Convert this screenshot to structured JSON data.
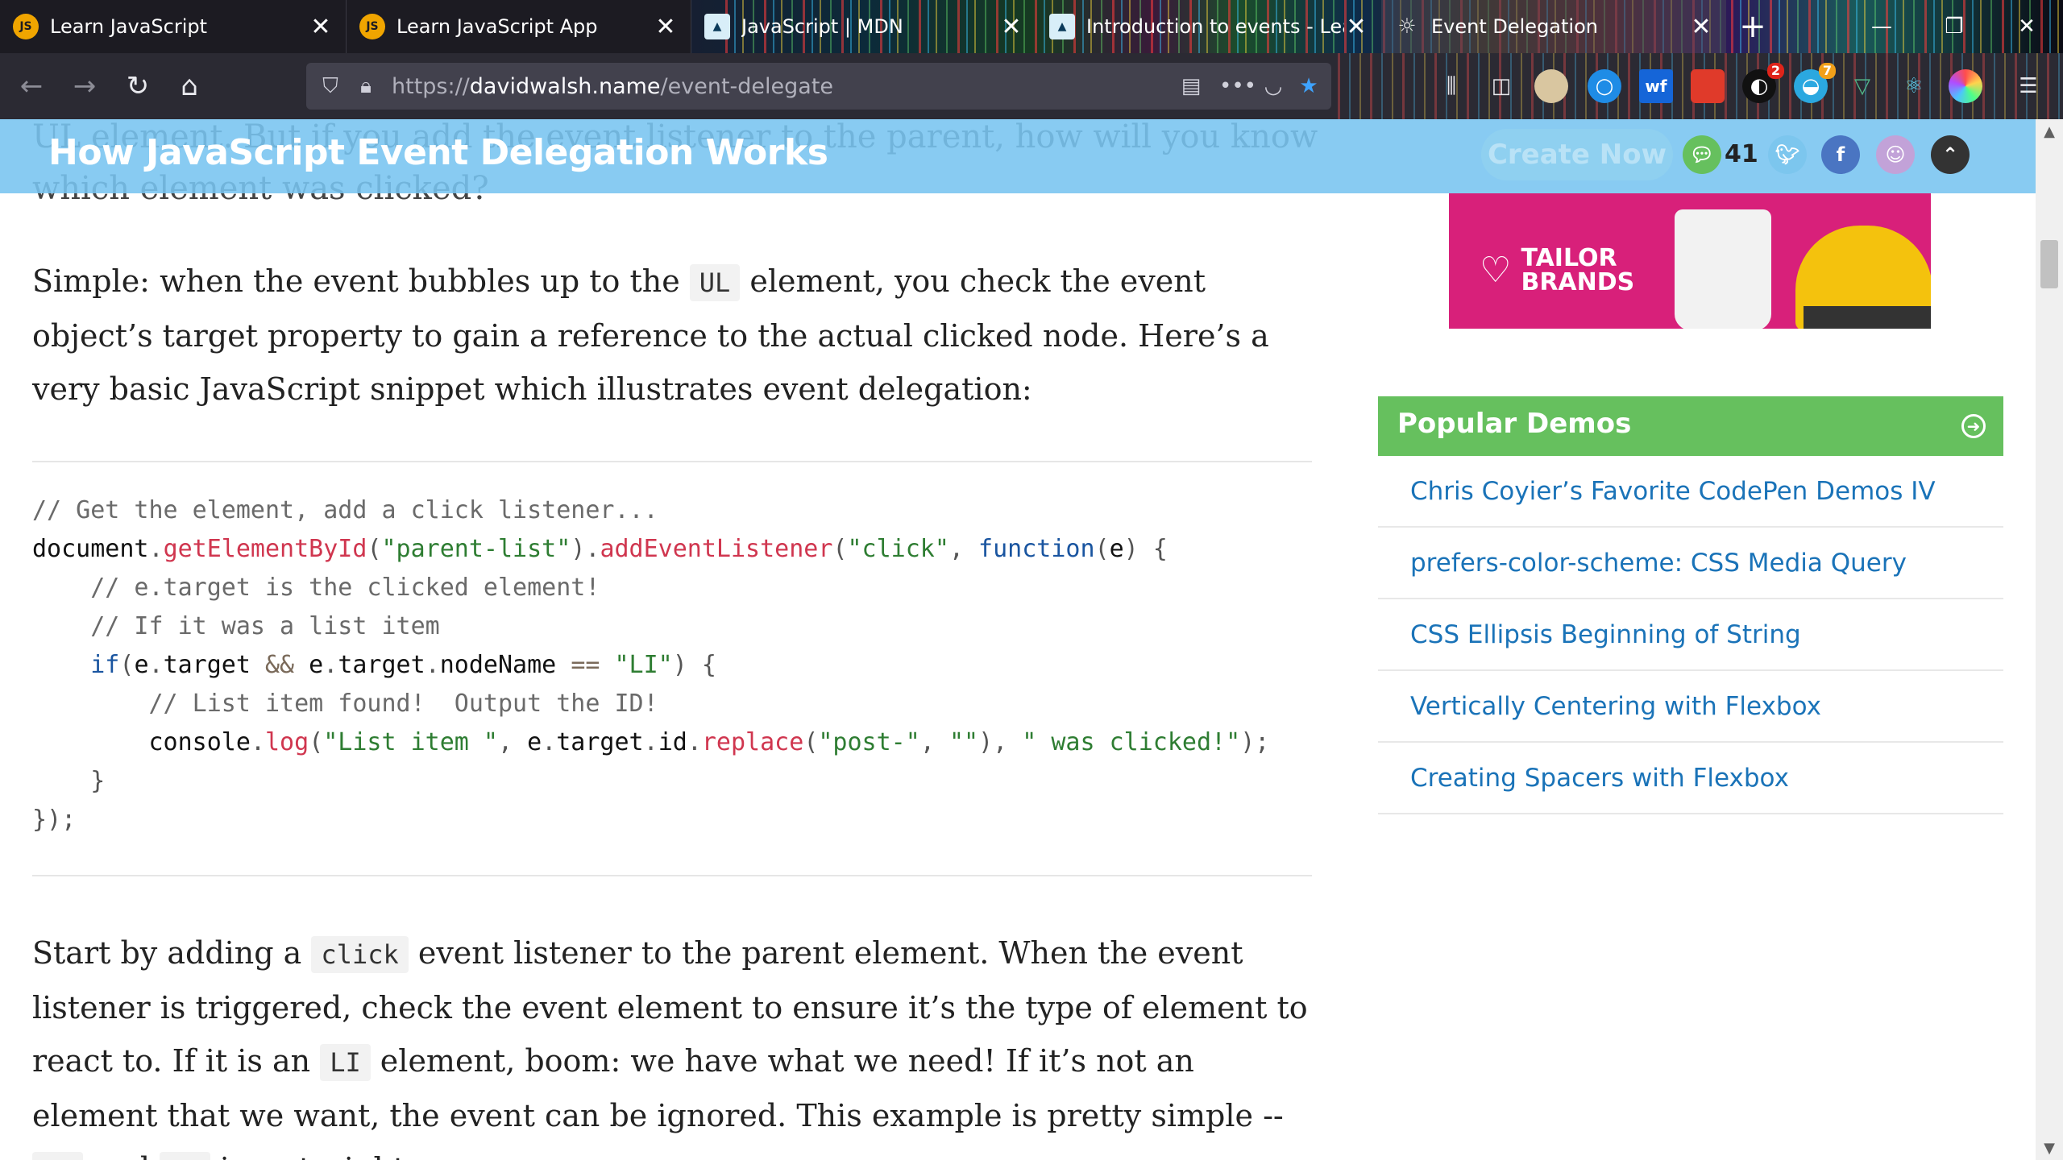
{
  "tabs": [
    {
      "title": "Learn JavaScript",
      "favicon": "JS"
    },
    {
      "title": "Learn JavaScript App",
      "favicon": "JS"
    },
    {
      "title": "JavaScript | MDN",
      "favicon": "mdn-icon"
    },
    {
      "title": "Introduction to events - Lear",
      "favicon": "mdn-icon"
    },
    {
      "title": "Event Delegation",
      "favicon": "site-icon"
    }
  ],
  "url": {
    "prefix": "https://",
    "domain": "davidwalsh.name",
    "path": "/event-delegate"
  },
  "extensions": {
    "badge_red": "2",
    "badge_orange": "7"
  },
  "page": {
    "sticky_title": "How JavaScript Event Delegation Works",
    "create_now": "Create Now",
    "comment_count": "41",
    "ghost_text": "UL element. But if you add the event listener to the parent, how will you know which element was clicked?",
    "para1": {
      "a": "Simple:  when the event bubbles up to the ",
      "code": "UL",
      "b": " element, you check the event object’s target property to gain a reference to the actual clicked node.  Here’s a very basic JavaScript snippet which illustrates event delegation:"
    },
    "code_lines": [
      "// Get the element, add a click listener...",
      "document.getElementById(\"parent-list\").addEventListener(\"click\", function(e) {",
      "    // e.target is the clicked element!",
      "    // If it was a list item",
      "    if(e.target && e.target.nodeName == \"LI\") {",
      "        // List item found!  Output the ID!",
      "        console.log(\"List item \", e.target.id.replace(\"post-\", \"\"), \" was clicked!\");",
      "    }",
      "});"
    ],
    "para2": {
      "a": "Start by adding a ",
      "code1": "click",
      "b": " event listener to the parent element.  When the event listener is triggered, check the event element to ensure it’s the type of element to react to.  If it is an ",
      "code2": "LI",
      "c": " element, boom:  we have what we need!  If it’s not an element that we want, the event can be ignored.  This example is pretty simple -- ",
      "code3": "UL",
      "d": " and ",
      "code4": "LI",
      "e": " is a straight-"
    }
  },
  "ad": {
    "brand_line1": "TAILOR",
    "brand_line2": "BRANDS"
  },
  "sidebar": {
    "popular_title": "Popular Demos",
    "demos": [
      "Chris Coyier’s Favorite CodePen Demos IV",
      "prefers-color-scheme: CSS Media Query",
      "CSS Ellipsis Beginning of String",
      "Vertically Centering with Flexbox",
      "Creating Spacers with Flexbox"
    ]
  },
  "colors": {
    "sticky_bg": "#78c4f0",
    "popular_bg": "#66c05e",
    "link": "#1a73b8",
    "ad_bg": "#d8207a"
  }
}
